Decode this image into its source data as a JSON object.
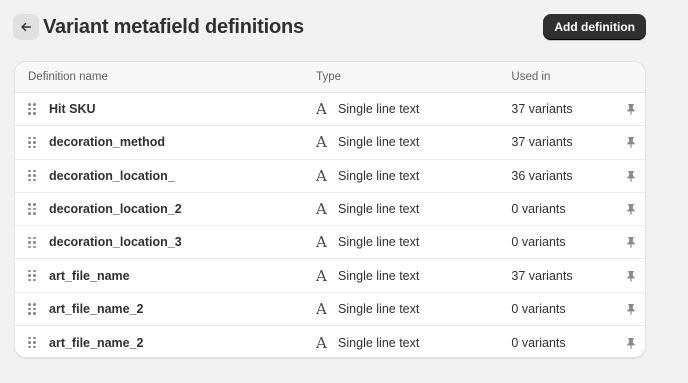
{
  "header": {
    "title": "Variant metafield definitions",
    "add_button_label": "Add definition"
  },
  "table": {
    "columns": {
      "name": "Definition name",
      "type": "Type",
      "used": "Used in"
    },
    "rows": [
      {
        "name": "Hit SKU",
        "type_glyph": "A",
        "type": "Single line text",
        "used": "37 variants"
      },
      {
        "name": "decoration_method",
        "type_glyph": "A",
        "type": "Single line text",
        "used": "37 variants"
      },
      {
        "name": "decoration_location_",
        "type_glyph": "A",
        "type": "Single line text",
        "used": "36 variants"
      },
      {
        "name": "decoration_location_2",
        "type_glyph": "A",
        "type": "Single line text",
        "used": "0 variants"
      },
      {
        "name": "decoration_location_3",
        "type_glyph": "A",
        "type": "Single line text",
        "used": "0 variants"
      },
      {
        "name": "art_file_name",
        "type_glyph": "A",
        "type": "Single line text",
        "used": "37 variants"
      },
      {
        "name": "art_file_name_2",
        "type_glyph": "A",
        "type": "Single line text",
        "used": "0 variants"
      },
      {
        "name": "art_file_name_2",
        "type_glyph": "A",
        "type": "Single line text",
        "used": "0 variants"
      }
    ]
  },
  "icons": {
    "back": "arrow-left-icon",
    "drag": "drag-handle-icon",
    "type": "text-type-icon",
    "pin": "pin-icon"
  },
  "colors": {
    "background": "#f1f1f1",
    "primary_button": "#303030",
    "card": "#ffffff"
  }
}
